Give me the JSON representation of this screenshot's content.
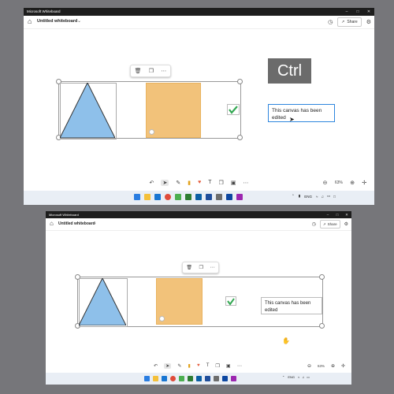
{
  "window": {
    "title": "Microsoft Whiteboard"
  },
  "header": {
    "doc_title": "Untitled whiteboard",
    "share_label": "Share"
  },
  "canvas": {
    "textbox_text": "This canvas has been edited",
    "key_overlay": "Ctrl"
  },
  "zoom": {
    "level": "63%"
  },
  "tray": {
    "lang": "ENG"
  },
  "colors": {
    "triangle": "#8ec0ea",
    "sticky_note": "#f2c27a",
    "checkmark": "#34a853",
    "textbox_border": "#2e86de",
    "titlebar": "#1d1d1d",
    "taskbar": "#e9eef5"
  },
  "icons": [
    "home-icon",
    "chevron-down-icon",
    "timer-icon",
    "share-icon",
    "settings-icon",
    "delete-icon",
    "copy-icon",
    "more-icon",
    "undo-icon",
    "select-icon",
    "pen-icon",
    "highlighter-icon",
    "reaction-icon",
    "text-icon",
    "shapes-icon",
    "template-icon",
    "zoom-out-icon",
    "zoom-in-icon",
    "fit-icon"
  ]
}
